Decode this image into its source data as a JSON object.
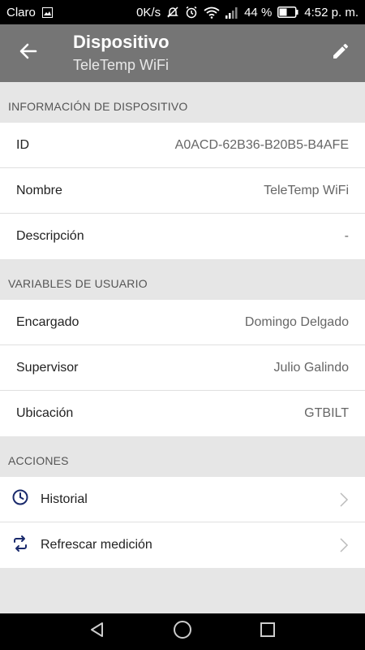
{
  "status_bar": {
    "carrier": "Claro",
    "data_speed": "0K/s",
    "battery": "44 %",
    "time": "4:52 p. m."
  },
  "app_bar": {
    "title": "Dispositivo",
    "subtitle": "TeleTemp WiFi",
    "back_icon": "arrow-back-icon",
    "edit_icon": "pencil-icon"
  },
  "sections": {
    "device": {
      "header": "INFORMACIÓN DE DISPOSITIVO",
      "rows": [
        {
          "label": "ID",
          "value": "A0ACD-62B36-B20B5-B4AFE"
        },
        {
          "label": "Nombre",
          "value": "TeleTemp WiFi"
        },
        {
          "label": "Descripción",
          "value": "-"
        }
      ]
    },
    "user_vars": {
      "header": "VARIABLES DE USUARIO",
      "rows": [
        {
          "label": "Encargado",
          "value": "Domingo Delgado"
        },
        {
          "label": "Supervisor",
          "value": "Julio Galindo"
        },
        {
          "label": "Ubicación",
          "value": "GTBILT"
        }
      ]
    },
    "actions": {
      "header": "ACCIONES",
      "items": [
        {
          "label": "Historial",
          "icon": "clock-icon"
        },
        {
          "label": "Refrescar medición",
          "icon": "refresh-icon"
        }
      ]
    }
  },
  "colors": {
    "app_bar": "#757575",
    "accent_icon": "#1a2a6c",
    "background": "#e6e6e6"
  }
}
